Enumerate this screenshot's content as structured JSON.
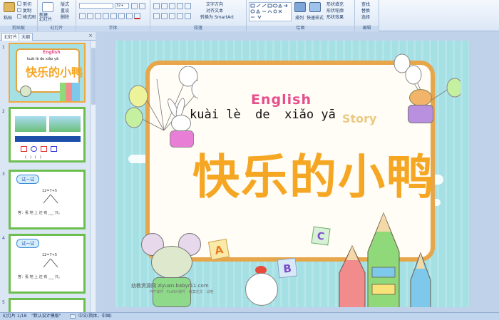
{
  "ribbon": {
    "clipboard": {
      "paste": "粘贴",
      "cut": "剪切",
      "copy": "复制",
      "format_painter": "格式刷",
      "label": "剪贴板"
    },
    "slides": {
      "new_slide": "新建\n幻灯片",
      "layout": "版式",
      "reset": "重设",
      "delete": "删除",
      "label": "幻灯片"
    },
    "font": {
      "size": "32+",
      "label": "字体"
    },
    "paragraph": {
      "text_direction": "文字方向",
      "align_text": "对齐文本",
      "smartart": "转换为 SmartArt",
      "label": "段落"
    },
    "drawing": {
      "arrange": "排列",
      "quick_styles": "快速样式",
      "shape_fill": "形状填充",
      "shape_outline": "形状轮廓",
      "shape_effects": "形状效果",
      "label": "绘图"
    },
    "editing": {
      "find": "查找",
      "replace": "替换",
      "select": "选择",
      "label": "编辑"
    }
  },
  "panel": {
    "tab_slides": "幻灯片",
    "tab_outline": "大纲",
    "close": "×"
  },
  "thumbnails": [
    {
      "num": "1",
      "title": "快乐的小鸭",
      "pinyin": "kuài lè de xiǎo yā",
      "english": "English"
    },
    {
      "num": "2",
      "cap": "(　)　(　)"
    },
    {
      "num": "3",
      "label": "试一试",
      "expr": "12=7+5",
      "ans": "答：看 地 上 还 有 ___ 只。"
    },
    {
      "num": "4",
      "label": "试一试",
      "expr": "12=7+5",
      "ans": "答：看 地 上 还 有 ___ 只。"
    },
    {
      "num": "5"
    }
  ],
  "slide": {
    "english": "English",
    "english_extra": "Story",
    "pinyin": [
      "kuài",
      "lè",
      "de",
      "xiǎo",
      "yā"
    ],
    "title": "快乐的小鸭",
    "watermark": "幼教资源网 ziyuan.babyr11.com",
    "watermark_sub": "PPT课件 · FLASH课件 · 教案论文 · 试卷",
    "blocks": [
      "A",
      "B",
      "C"
    ]
  },
  "status": {
    "slide_of": "幻灯片 1/18",
    "theme": "\"默认设计模板\"",
    "language": "中文(简体，中国)"
  },
  "colors": {
    "title_orange": "#f5a623",
    "slide_bg": "#a4e0e4"
  }
}
